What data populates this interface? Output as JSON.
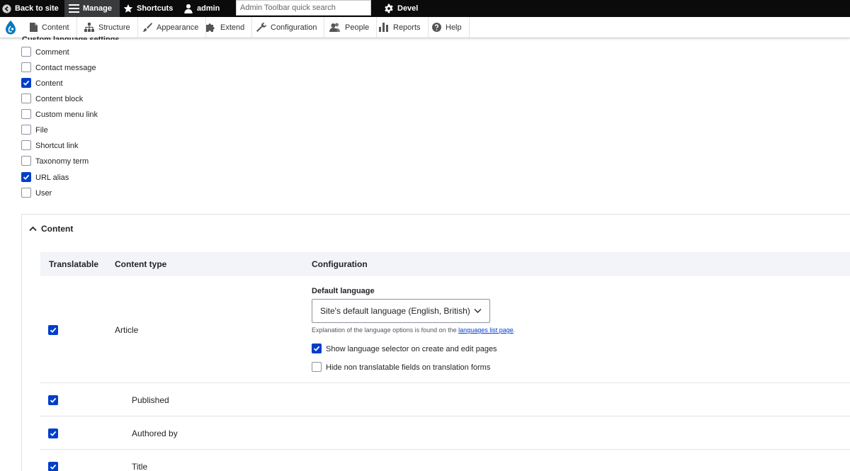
{
  "toolbar": {
    "back_to_site": "Back to site",
    "manage": "Manage",
    "shortcuts": "Shortcuts",
    "user": "admin",
    "search_placeholder": "Admin Toolbar quick search",
    "devel": "Devel"
  },
  "admin_menu": {
    "items": [
      {
        "label": "Content",
        "icon": "file-icon"
      },
      {
        "label": "Structure",
        "icon": "sitemap-icon"
      },
      {
        "label": "Appearance",
        "icon": "paintbrush-icon"
      },
      {
        "label": "Extend",
        "icon": "puzzle-icon"
      },
      {
        "label": "Configuration",
        "icon": "wrench-icon"
      },
      {
        "label": "People",
        "icon": "people-icon"
      },
      {
        "label": "Reports",
        "icon": "bar-chart-icon"
      },
      {
        "label": "Help",
        "icon": "help-icon"
      }
    ]
  },
  "custom_language_settings": {
    "heading": "Custom language settings",
    "options": [
      {
        "label": "Comment",
        "checked": false
      },
      {
        "label": "Contact message",
        "checked": false
      },
      {
        "label": "Content",
        "checked": true
      },
      {
        "label": "Content block",
        "checked": false
      },
      {
        "label": "Custom menu link",
        "checked": false
      },
      {
        "label": "File",
        "checked": false
      },
      {
        "label": "Shortcut link",
        "checked": false
      },
      {
        "label": "Taxonomy term",
        "checked": false
      },
      {
        "label": "URL alias",
        "checked": true
      },
      {
        "label": "User",
        "checked": false
      }
    ]
  },
  "content_panel": {
    "title": "Content",
    "columns": {
      "translatable": "Translatable",
      "content_type": "Content type",
      "configuration": "Configuration"
    },
    "article": {
      "name": "Article",
      "translatable": true,
      "default_language_label": "Default language",
      "default_language_value": "Site's default language (English, British)",
      "help_prefix": "Explanation of the language options is found on the ",
      "help_link": "languages list page",
      "help_suffix": ".",
      "show_selector_label": "Show language selector on create and edit pages",
      "show_selector_checked": true,
      "hide_non_translatable_label": "Hide non translatable fields on translation forms",
      "hide_non_translatable_checked": false
    },
    "fields": [
      {
        "label": "Published",
        "checked": true
      },
      {
        "label": "Authored by",
        "checked": true
      },
      {
        "label": "Title",
        "checked": true
      }
    ]
  },
  "colors": {
    "checkbox_checked": "#003ecc",
    "toolbar_bg": "#0b0b0b",
    "link": "#003ecc"
  }
}
